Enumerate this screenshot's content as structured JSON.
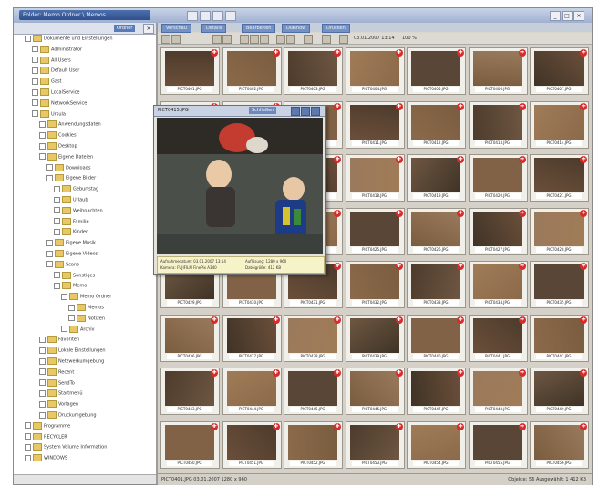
{
  "window": {
    "title": "Folder: Memo Ordner \\ Memos"
  },
  "folder_pane": {
    "tab_label": "Ordner",
    "tree": [
      {
        "label": "Dokumente und Einstellungen",
        "level": 1
      },
      {
        "label": "Administrator",
        "level": 2
      },
      {
        "label": "All Users",
        "level": 2
      },
      {
        "label": "Default User",
        "level": 2
      },
      {
        "label": "Gast",
        "level": 2
      },
      {
        "label": "LocalService",
        "level": 2
      },
      {
        "label": "NetworkService",
        "level": 2
      },
      {
        "label": "Ursula",
        "level": 2
      },
      {
        "label": "Anwendungsdaten",
        "level": 3
      },
      {
        "label": "Cookies",
        "level": 3
      },
      {
        "label": "Desktop",
        "level": 3
      },
      {
        "label": "Eigene Dateien",
        "level": 3
      },
      {
        "label": "Downloads",
        "level": 4
      },
      {
        "label": "Eigene Bilder",
        "level": 4
      },
      {
        "label": "Geburtstag",
        "level": 5
      },
      {
        "label": "Urlaub",
        "level": 5
      },
      {
        "label": "Weihnachten",
        "level": 5
      },
      {
        "label": "Familie",
        "level": 5
      },
      {
        "label": "Kinder",
        "level": 5
      },
      {
        "label": "Eigene Musik",
        "level": 4
      },
      {
        "label": "Eigene Videos",
        "level": 4
      },
      {
        "label": "Scans",
        "level": 4
      },
      {
        "label": "Sonstiges",
        "level": 5
      },
      {
        "label": "Memo",
        "level": 5
      },
      {
        "label": "Memo Ordner",
        "level": 6
      },
      {
        "label": "Memos",
        "level": 7
      },
      {
        "label": "Notizen",
        "level": 7
      },
      {
        "label": "Archiv",
        "level": 6
      },
      {
        "label": "Favoriten",
        "level": 3
      },
      {
        "label": "Lokale Einstellungen",
        "level": 3
      },
      {
        "label": "Netzwerkumgebung",
        "level": 3
      },
      {
        "label": "Recent",
        "level": 3
      },
      {
        "label": "SendTo",
        "level": 3
      },
      {
        "label": "Startmenü",
        "level": 3
      },
      {
        "label": "Vorlagen",
        "level": 3
      },
      {
        "label": "Druckumgebung",
        "level": 3
      },
      {
        "label": "Programme",
        "level": 1
      },
      {
        "label": "RECYCLER",
        "level": 1
      },
      {
        "label": "System Volume Information",
        "level": 1
      },
      {
        "label": "WINDOWS",
        "level": 1
      }
    ]
  },
  "view_tabs": [
    "Vorschau",
    "Details",
    "Bearbeiten",
    "Diashow",
    "Drucken"
  ],
  "toolbar": {
    "date_text": "03.01.2007 13:14",
    "zoom_text": "100 %"
  },
  "preview": {
    "filename": "PICT0415.JPG",
    "button_label": "Schließen",
    "info": {
      "line1": "Aufnahmedatum: 03.01.2007 13:14",
      "line2": "Kamera: FUJIFILM FinePix A340",
      "line3": "Auflösung: 1280 x 960",
      "line4": "Dateigröße: 412 KB"
    }
  },
  "thumbnails": {
    "filenames": [
      "PICT0401.JPG",
      "PICT0402.JPG",
      "PICT0403.JPG",
      "PICT0404.JPG",
      "PICT0405.JPG",
      "PICT0406.JPG",
      "PICT0407.JPG",
      "PICT0408.JPG",
      "PICT0409.JPG",
      "PICT0410.JPG",
      "PICT0411.JPG",
      "PICT0412.JPG",
      "PICT0413.JPG",
      "PICT0414.JPG",
      "PICT0415.JPG",
      "PICT0416.JPG",
      "PICT0417.JPG",
      "PICT0418.JPG",
      "PICT0419.JPG",
      "PICT0420.JPG",
      "PICT0421.JPG",
      "PICT0422.JPG",
      "PICT0423.JPG",
      "PICT0424.JPG",
      "PICT0425.JPG",
      "PICT0426.JPG",
      "PICT0427.JPG",
      "PICT0428.JPG",
      "PICT0429.JPG",
      "PICT0430.JPG",
      "PICT0431.JPG",
      "PICT0432.JPG",
      "PICT0433.JPG",
      "PICT0434.JPG",
      "PICT0435.JPG",
      "PICT0436.JPG",
      "PICT0437.JPG",
      "PICT0438.JPG",
      "PICT0439.JPG",
      "PICT0440.JPG",
      "PICT0441.JPG",
      "PICT0442.JPG",
      "PICT0443.JPG",
      "PICT0444.JPG",
      "PICT0445.JPG",
      "PICT0446.JPG",
      "PICT0447.JPG",
      "PICT0448.JPG",
      "PICT0449.JPG",
      "PICT0450.JPG",
      "PICT0451.JPG",
      "PICT0452.JPG",
      "PICT0453.JPG",
      "PICT0454.JPG",
      "PICT0455.JPG",
      "PICT0456.JPG"
    ],
    "mark_glyph": "✚",
    "photo_colors": [
      "#6b4f3a",
      "#8b6a4a",
      "#4d3b2c",
      "#a07b57",
      "#5a4636",
      "#7a5c3f",
      "#3f3326",
      "#9a7a5c",
      "#6e5742",
      "#826246"
    ]
  },
  "status": {
    "left": "PICT0401.JPG  03.01.2007  1280 x 960",
    "right": "Objekte: 56    Ausgewählt: 1    412 KB"
  },
  "colors": {
    "accent": "#5a7bb8",
    "mark": "#d82b2b",
    "folder": "#e8c866"
  }
}
